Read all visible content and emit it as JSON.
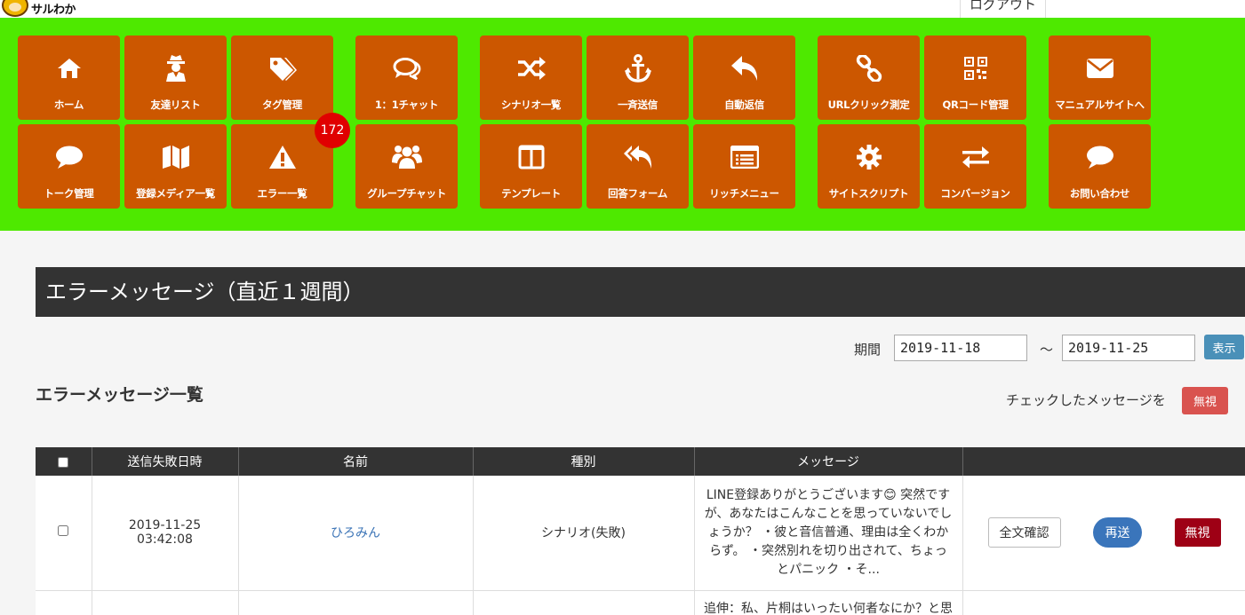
{
  "app": {
    "logo_text": "サルわか",
    "logout_label": "ログアウト"
  },
  "nav": {
    "tiles": [
      {
        "label": "ホーム",
        "icon": "home-icon"
      },
      {
        "label": "友達リスト",
        "icon": "user-secret-icon"
      },
      {
        "label": "タグ管理",
        "icon": "tags-icon"
      },
      {
        "label": "1：1チャット",
        "icon": "comments-icon"
      },
      {
        "label": "シナリオ一覧",
        "icon": "shuffle-icon"
      },
      {
        "label": "一斉送信",
        "icon": "anchor-icon"
      },
      {
        "label": "自動返信",
        "icon": "reply-icon"
      },
      {
        "label": "URLクリック測定",
        "icon": "link-icon"
      },
      {
        "label": "QRコード管理",
        "icon": "qrcode-icon"
      },
      {
        "label": "マニュアルサイトへ",
        "icon": "envelope-icon"
      },
      {
        "label": "トーク管理",
        "icon": "comment-icon"
      },
      {
        "label": "登録メディア一覧",
        "icon": "map-icon"
      },
      {
        "label": "エラー一覧",
        "icon": "warning-icon"
      },
      {
        "label": "グループチャット",
        "icon": "users-icon"
      },
      {
        "label": "テンプレート",
        "icon": "columns-icon"
      },
      {
        "label": "回答フォーム",
        "icon": "reply-all-icon"
      },
      {
        "label": "リッチメニュー",
        "icon": "list-alt-icon"
      },
      {
        "label": "サイトスクリプト",
        "icon": "gear-icon"
      },
      {
        "label": "コンバージョン",
        "icon": "exchange-icon"
      },
      {
        "label": "お問い合わせ",
        "icon": "comment-icon"
      }
    ],
    "error_badge": "172"
  },
  "section": {
    "title": "エラーメッセージ（直近１週間）"
  },
  "filter": {
    "period_label": "期間",
    "from": "2019-11-18",
    "separator": "～",
    "to": "2019-11-25",
    "show_label": "表示"
  },
  "list": {
    "title": "エラーメッセージ一覧",
    "checked_label": "チェックしたメッセージを",
    "ignore_label": "無視"
  },
  "table": {
    "headers": [
      "",
      "送信失敗日時",
      "名前",
      "種別",
      "メッセージ",
      ""
    ],
    "rows": [
      {
        "date": "2019-11-25",
        "time": "03:42:08",
        "name": "ひろみん",
        "type": "シナリオ(失敗)",
        "message": "LINE登録ありがとうございます😊 突然ですが、あなたはこんなことを思っていないでしょうか？ ・彼と音信普通、理由は全くわからず。 ・突然別れを切り出されて、ちょっとパニック ・そ...",
        "full_label": "全文確認",
        "resend_label": "再送",
        "ignore_label": "無視"
      },
      {
        "message": "追伸：私、片桐はいったい何者なにか？と思"
      }
    ]
  },
  "colors": {
    "nav_bg": "#4ee900",
    "tile_bg": "#cc5700",
    "badge": "#e00000",
    "header_dark": "#333333"
  }
}
